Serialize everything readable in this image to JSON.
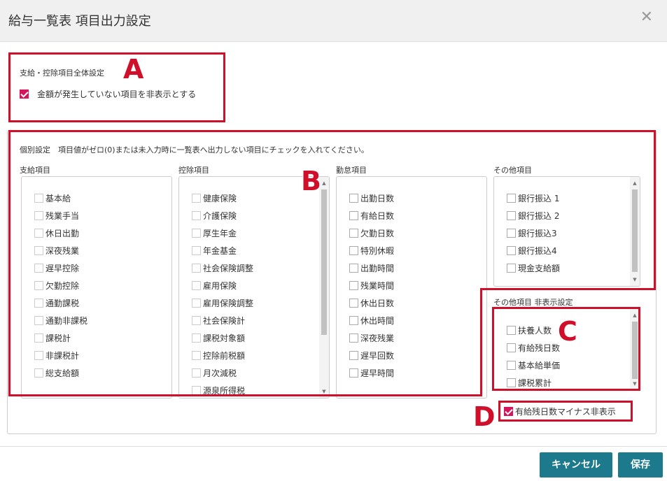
{
  "dialog": {
    "title": "給与一覧表 項目出力設定"
  },
  "global": {
    "heading": "支給・控除項目全体設定",
    "hide_zero_label": "金額が発生していない項目を非表示とする",
    "hide_zero_checked": true
  },
  "individual": {
    "description": "個別設定　項目値がゼロ(0)または未入力時に一覧表へ出力しない項目にチェックを入れてください。"
  },
  "columns": {
    "payment": {
      "label": "支給項目",
      "items": [
        "基本給",
        "残業手当",
        "休日出勤",
        "深夜残業",
        "遅早控除",
        "欠勤控除",
        "通勤課税",
        "通勤非課税",
        "課税計",
        "非課税計",
        "総支給額"
      ]
    },
    "deduction": {
      "label": "控除項目",
      "items": [
        "健康保険",
        "介護保険",
        "厚生年金",
        "年金基金",
        "社会保険調整",
        "雇用保険",
        "雇用保険調整",
        "社会保険計",
        "課税対象額",
        "控除前税額",
        "月次減税",
        "源泉所得税"
      ]
    },
    "attendance": {
      "label": "勤怠項目",
      "items": [
        "出勤日数",
        "有給日数",
        "欠勤日数",
        "特別休暇",
        "出勤時間",
        "残業時間",
        "休出日数",
        "休出時間",
        "深夜残業",
        "遅早回数",
        "遅早時間"
      ]
    },
    "other": {
      "label": "その他項目",
      "items": [
        "銀行振込 1",
        "銀行振込 2",
        "銀行振込3",
        "銀行振込4",
        "現金支給額"
      ]
    },
    "other_hidden": {
      "label": "その他項目 非表示設定",
      "items": [
        "扶養人数",
        "有給残日数",
        "基本給単価",
        "課税累計"
      ]
    }
  },
  "negative_paid_leave": {
    "label": "有給残日数マイナス非表示",
    "checked": true
  },
  "markers": {
    "a": "A",
    "b": "B",
    "c": "C",
    "d": "D"
  },
  "buttons": {
    "cancel": "キャンセル",
    "save": "保存"
  },
  "colors": {
    "accent_check": "#d6165c",
    "primary_button": "#1c7a8c",
    "annotation": "#d0102a"
  }
}
